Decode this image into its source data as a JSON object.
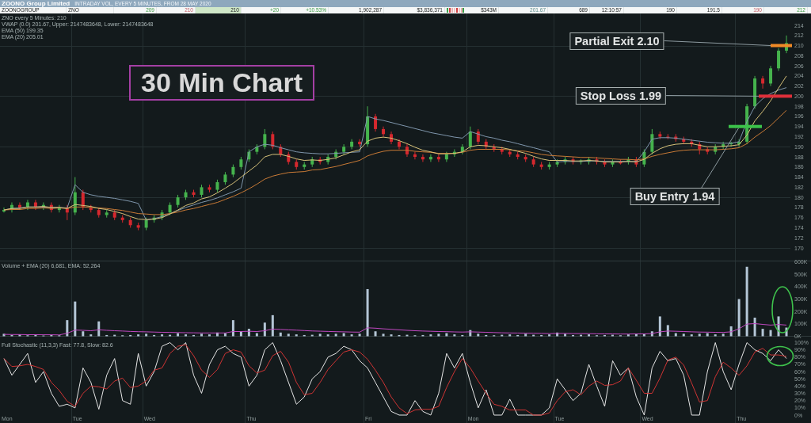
{
  "title_bar": {
    "title": "ZOONO Group Limited",
    "subtitle": "INTRADAY VOL, EVERY 5 MINUTES, FROM 28 MAY 2020"
  },
  "quote_row": [
    {
      "kind": "label",
      "text": "ZOONOGROUP",
      "highlight": false
    },
    {
      "kind": "label",
      "text": "ZNO",
      "highlight": false
    },
    {
      "kind": "gain",
      "text": "209",
      "highlight": false
    },
    {
      "kind": "loss",
      "text": "210",
      "highlight": false
    },
    {
      "kind": "value",
      "text": "210",
      "highlight": true
    },
    {
      "kind": "gain",
      "text": "+20",
      "highlight": false
    },
    {
      "kind": "gain",
      "text": "+10.53%",
      "highlight": false
    },
    {
      "kind": "value",
      "text": "1,902,287",
      "highlight": false
    },
    {
      "kind": "value",
      "text": "$3,836,371",
      "highlight": false
    },
    {
      "kind": "bars"
    },
    {
      "kind": "value",
      "text": "$343M",
      "highlight": false
    },
    {
      "kind": "average",
      "text": "201.67",
      "highlight": false
    },
    {
      "kind": "value",
      "text": "689",
      "highlight": false
    },
    {
      "kind": "value",
      "text": "12:10:57",
      "highlight": false
    },
    {
      "kind": "value",
      "text": "190",
      "highlight": false
    },
    {
      "kind": "value",
      "text": "191.5",
      "highlight": false
    },
    {
      "kind": "loss",
      "text": "190",
      "highlight": false
    },
    {
      "kind": "gain",
      "text": "212",
      "highlight": false
    }
  ],
  "price_panel": {
    "legend": [
      "ZNO every 5 Minutes: 210",
      "VWAP (0.0) 201.67, Upper: 2147483648, Lower: 2147483648",
      "EMA (50) 199.35",
      "EMA (20) 205.01"
    ],
    "chart_data": {
      "type": "candlestick",
      "title": "30 Min Chart",
      "grid": true,
      "ylim": [
        170,
        214
      ],
      "yticks": [
        170,
        172,
        174,
        176,
        178,
        180,
        182,
        184,
        186,
        188,
        190,
        192,
        194,
        196,
        198,
        200,
        202,
        204,
        206,
        208,
        210,
        212,
        214
      ],
      "ohlc": [
        [
          177.2,
          178,
          177,
          177.5
        ],
        [
          177.5,
          179,
          177,
          178.5
        ],
        [
          178.5,
          179,
          177.5,
          178
        ],
        [
          178,
          179.5,
          177.5,
          179
        ],
        [
          179,
          179.5,
          177.5,
          178
        ],
        [
          178,
          179,
          177.5,
          178.5
        ],
        [
          178.5,
          179,
          177,
          177.5
        ],
        [
          177.5,
          178.5,
          177,
          178
        ],
        [
          178,
          178.5,
          175.5,
          177
        ],
        [
          177,
          184,
          176.5,
          181
        ],
        [
          181,
          181.5,
          177.5,
          178
        ],
        [
          178,
          178.5,
          177,
          177.5
        ],
        [
          177.5,
          178,
          176,
          176.5
        ],
        [
          176.5,
          177.5,
          176,
          177
        ],
        [
          177,
          177.5,
          175.5,
          176
        ],
        [
          176,
          176.5,
          175,
          175.5
        ],
        [
          175.5,
          176,
          174,
          174.5
        ],
        [
          174.5,
          175,
          173.5,
          174
        ],
        [
          174,
          176,
          173.5,
          175.5
        ],
        [
          175.5,
          176.5,
          175,
          176
        ],
        [
          176,
          177.5,
          175.5,
          177
        ],
        [
          177,
          179,
          176.5,
          178.5
        ],
        [
          178.5,
          180.5,
          178,
          180
        ],
        [
          180,
          181.5,
          179.5,
          181
        ],
        [
          181,
          181.5,
          180,
          180.5
        ],
        [
          180.5,
          182.5,
          180,
          182
        ],
        [
          182,
          182.5,
          181,
          181.5
        ],
        [
          181.5,
          183.5,
          181,
          183
        ],
        [
          183,
          185,
          182.5,
          184.5
        ],
        [
          184.5,
          186.5,
          184,
          186
        ],
        [
          186,
          188,
          185.5,
          187.5
        ],
        [
          187.5,
          189.5,
          187,
          189
        ],
        [
          189,
          190.5,
          188.5,
          190
        ],
        [
          190,
          193.5,
          189.5,
          192.5
        ],
        [
          192.5,
          193,
          189.5,
          190
        ],
        [
          190,
          190.5,
          188,
          188.5
        ],
        [
          188.5,
          189,
          186.5,
          187
        ],
        [
          187,
          187.5,
          185.5,
          186
        ],
        [
          186,
          187,
          185.5,
          186.5
        ],
        [
          186.5,
          188,
          186,
          187.5
        ],
        [
          187.5,
          188,
          186.5,
          187
        ],
        [
          187,
          188.5,
          186.5,
          188
        ],
        [
          188,
          189.5,
          187.5,
          189
        ],
        [
          189,
          190.5,
          188.5,
          190
        ],
        [
          190,
          191.5,
          189.5,
          191
        ],
        [
          191,
          191.5,
          190,
          190.5
        ],
        [
          190.5,
          198,
          190,
          196
        ],
        [
          196,
          196.5,
          193,
          193.5
        ],
        [
          193.5,
          194,
          192,
          192.5
        ],
        [
          192.5,
          193,
          190.5,
          191
        ],
        [
          191,
          191.5,
          189.5,
          190
        ],
        [
          190,
          190.5,
          188,
          188.5
        ],
        [
          188.5,
          189,
          187.5,
          188
        ],
        [
          188,
          188.5,
          187,
          187.5
        ],
        [
          187.5,
          188.5,
          187,
          188
        ],
        [
          188,
          188.5,
          187,
          187.5
        ],
        [
          187.5,
          189,
          187,
          188.5
        ],
        [
          188.5,
          189.5,
          188,
          189
        ],
        [
          189,
          190.5,
          188.5,
          190
        ],
        [
          190,
          194,
          189.5,
          193
        ],
        [
          193,
          193.5,
          190.5,
          191
        ],
        [
          191,
          191.5,
          189.5,
          190
        ],
        [
          190,
          190.5,
          189,
          189.5
        ],
        [
          189.5,
          190,
          188.5,
          189
        ],
        [
          189,
          189.5,
          188,
          188.5
        ],
        [
          188.5,
          189,
          187.5,
          188
        ],
        [
          188,
          188.5,
          187,
          187.5
        ],
        [
          187.5,
          188,
          186,
          186.5
        ],
        [
          186.5,
          187,
          185.5,
          186
        ],
        [
          186,
          187,
          185.5,
          186.5
        ],
        [
          186.5,
          187.5,
          186,
          187
        ],
        [
          187,
          188,
          186.5,
          187.5
        ],
        [
          187.5,
          188,
          186.5,
          187
        ],
        [
          187,
          187.5,
          186.5,
          187.3
        ],
        [
          187,
          188,
          186.5,
          187.5
        ],
        [
          187.5,
          188,
          186.5,
          187
        ],
        [
          187,
          187.5,
          186,
          186.5
        ],
        [
          186.5,
          187.5,
          186,
          187
        ],
        [
          187,
          187.5,
          186.5,
          186.7
        ],
        [
          187,
          188,
          186.5,
          187.5
        ],
        [
          187.5,
          188,
          186,
          186.5
        ],
        [
          186.5,
          189.5,
          186,
          189
        ],
        [
          189,
          193.5,
          188.5,
          192.5
        ],
        [
          192.5,
          193,
          191.5,
          192
        ],
        [
          192,
          192.5,
          191.5,
          191.8
        ],
        [
          192,
          192.5,
          191,
          191.5
        ],
        [
          191.5,
          192,
          190.5,
          191
        ],
        [
          191,
          191.5,
          190,
          190.5
        ],
        [
          190.5,
          191,
          188.5,
          189.5
        ],
        [
          189.5,
          190,
          188.5,
          189
        ],
        [
          189,
          190.5,
          188.5,
          190
        ],
        [
          190,
          191,
          189.5,
          190.5
        ],
        [
          190.5,
          191,
          190,
          190.7
        ],
        [
          190.5,
          191.5,
          190,
          191
        ],
        [
          191,
          198.5,
          190.5,
          198
        ],
        [
          198,
          204,
          197.5,
          203.5
        ],
        [
          203.5,
          204,
          201.5,
          202.5
        ],
        [
          202.5,
          206,
          202,
          205.5
        ],
        [
          205.5,
          209.5,
          205,
          209
        ],
        [
          209,
          212,
          208.5,
          210.5
        ]
      ],
      "series": [
        {
          "type": "line",
          "color": "#7f96ac",
          "values": [
            177.5,
            177.8,
            177.9,
            178.1,
            178.1,
            178.1,
            178.0,
            178.0,
            177.9,
            182.5,
            181.0,
            180.5,
            180.2,
            180.0,
            179.8,
            179.5,
            179.2,
            178.8,
            175.5,
            175.8,
            176.2,
            176.8,
            177.4,
            178.0,
            178.5,
            179.0,
            179.4,
            179.9,
            180.5,
            181.1,
            181.8,
            189.0,
            190.0,
            190.5,
            190.3,
            189.8,
            189.4,
            189.0,
            188.8,
            188.7,
            188.6,
            188.6,
            188.7,
            188.8,
            188.9,
            189.0,
            196.0,
            195.5,
            195.2,
            194.8,
            194.4,
            194.0,
            193.6,
            193.2,
            192.8,
            192.5,
            192.2,
            191.9,
            191.7,
            193.0,
            192.5,
            192.0,
            191.7,
            191.3,
            191.0,
            190.6,
            190.2,
            189.8,
            189.4,
            189.0,
            187.0,
            187.1,
            187.1,
            187.1,
            187.2,
            187.2,
            187.1,
            187.1,
            187.1,
            187.1,
            187.1,
            189.0,
            191.5,
            191.8,
            191.8,
            191.7,
            191.5,
            191.3,
            191.1,
            190.9,
            190.8,
            190.7,
            190.7,
            191.0,
            195.0,
            198.0,
            199.5,
            200.5,
            201.2,
            201.7
          ]
        },
        {
          "type": "line",
          "color": "#c97a36",
          "values": [
            177.5,
            177.6,
            177.6,
            177.8,
            177.8,
            177.9,
            177.8,
            177.9,
            177.8,
            178.1,
            178.1,
            178.0,
            177.9,
            177.8,
            177.6,
            177.4,
            177.1,
            176.8,
            176.7,
            176.6,
            176.6,
            176.8,
            177.1,
            177.5,
            177.8,
            178.2,
            178.6,
            179.0,
            179.6,
            180.2,
            180.9,
            181.7,
            182.6,
            183.6,
            184.2,
            184.6,
            184.9,
            185.0,
            185.1,
            185.4,
            185.5,
            185.8,
            186.1,
            186.5,
            186.9,
            187.3,
            188.2,
            188.7,
            189.1,
            189.3,
            189.3,
            189.3,
            189.1,
            189.0,
            188.9,
            188.7,
            188.7,
            188.7,
            188.9,
            189.3,
            189.5,
            189.5,
            189.5,
            189.5,
            189.4,
            189.2,
            189.1,
            188.8,
            188.5,
            188.3,
            188.2,
            188.1,
            188.0,
            187.9,
            187.9,
            187.8,
            187.7,
            187.6,
            187.5,
            187.5,
            187.4,
            187.6,
            188.1,
            188.5,
            188.8,
            189.1,
            189.3,
            189.4,
            189.4,
            189.4,
            189.4,
            189.5,
            189.6,
            189.8,
            190.6,
            191.9,
            193.0,
            194.2,
            195.7,
            197.2
          ]
        },
        {
          "type": "line",
          "color": "#d8c27a",
          "values": [
            177.5,
            177.8,
            177.8,
            178.1,
            178.1,
            178.2,
            178.0,
            178.0,
            177.8,
            178.6,
            178.4,
            178.2,
            177.8,
            177.6,
            177.2,
            176.8,
            176.2,
            175.7,
            175.6,
            175.7,
            176.0,
            176.7,
            177.5,
            178.4,
            178.9,
            179.7,
            180.1,
            180.9,
            181.8,
            182.8,
            184.0,
            185.2,
            186.4,
            188.0,
            188.5,
            188.5,
            188.1,
            187.6,
            187.3,
            187.4,
            187.3,
            187.5,
            187.8,
            188.4,
            189.0,
            189.4,
            191.1,
            191.7,
            191.9,
            191.7,
            191.2,
            190.6,
            189.9,
            189.3,
            189.0,
            188.6,
            188.6,
            188.7,
            189.0,
            190.0,
            190.3,
            190.2,
            190.0,
            189.8,
            189.5,
            189.1,
            188.7,
            188.1,
            187.6,
            187.3,
            187.3,
            187.3,
            187.2,
            187.2,
            187.3,
            187.2,
            187.0,
            187.0,
            187.0,
            187.1,
            187.0,
            187.5,
            188.7,
            189.6,
            190.2,
            190.5,
            190.6,
            190.6,
            190.3,
            190.0,
            190.0,
            190.1,
            190.2,
            190.4,
            192.3,
            195.1,
            197.0,
            199.1,
            201.6,
            204.0
          ]
        }
      ]
    },
    "callouts": [
      {
        "text": "Partial Exit 2.10",
        "color": "#f08a26"
      },
      {
        "text": "Stop Loss 1.99",
        "color": "#e0303a"
      },
      {
        "text": "Buy Entry 1.94",
        "color": "#3cc24a"
      }
    ]
  },
  "volume_panel": {
    "legend": "Volume + EMA (20) 6,681, EMA: 52,264",
    "chart_data": {
      "type": "bar",
      "grid": true,
      "ylim": [
        0,
        600
      ],
      "yticks": [
        {
          "value": 0,
          "label": "0K"
        },
        {
          "value": 100,
          "label": "100K"
        },
        {
          "value": 200,
          "label": "200K"
        },
        {
          "value": 300,
          "label": "300K"
        },
        {
          "value": 400,
          "label": "400K"
        },
        {
          "value": 500,
          "label": "500K"
        },
        {
          "value": 600,
          "label": "600K"
        }
      ],
      "series": [
        {
          "color": "#b4c6d6",
          "values": [
            20,
            10,
            15,
            8,
            12,
            6,
            10,
            8,
            130,
            280,
            40,
            15,
            120,
            10,
            12,
            8,
            10,
            15,
            20,
            10,
            15,
            12,
            25,
            15,
            10,
            20,
            15,
            30,
            25,
            130,
            40,
            60,
            25,
            110,
            170,
            30,
            20,
            15,
            10,
            12,
            20,
            15,
            20,
            25,
            15,
            20,
            380,
            40,
            20,
            15,
            10,
            12,
            8,
            10,
            15,
            20,
            25,
            15,
            10,
            50,
            20,
            10,
            8,
            12,
            15,
            10,
            20,
            12,
            10,
            15,
            30,
            20,
            10,
            12,
            15,
            8,
            10,
            12,
            8,
            15,
            20,
            20,
            40,
            160,
            90,
            25,
            20,
            15,
            20,
            25,
            15,
            20,
            80,
            300,
            560,
            150,
            60,
            50,
            160,
            70
          ]
        },
        {
          "type": "line",
          "color": "#c048c0",
          "values": [
            15,
            14,
            14,
            13,
            13,
            12,
            12,
            11,
            24,
            50,
            48,
            45,
            52,
            48,
            45,
            42,
            39,
            37,
            36,
            34,
            32,
            31,
            30,
            29,
            28,
            27,
            27,
            27,
            27,
            38,
            38,
            40,
            38,
            45,
            58,
            55,
            52,
            49,
            46,
            43,
            41,
            39,
            37,
            36,
            34,
            33,
            68,
            65,
            60,
            56,
            52,
            48,
            45,
            42,
            40,
            38,
            37,
            35,
            34,
            36,
            34,
            32,
            30,
            28,
            27,
            26,
            25,
            24,
            23,
            22,
            23,
            23,
            22,
            22,
            21,
            20,
            19,
            19,
            18,
            18,
            19,
            19,
            22,
            36,
            42,
            40,
            38,
            36,
            34,
            33,
            32,
            31,
            36,
            60,
            98,
            102,
            96,
            90,
            95,
            90
          ]
        }
      ]
    }
  },
  "stochastic_panel": {
    "legend": "Full Stochastic (11,3,3) Fast: 77.8, Slow: 82.6",
    "chart_data": {
      "type": "line",
      "grid": true,
      "ylim": [
        0,
        100
      ],
      "yticks": [
        {
          "value": 0,
          "label": "0%"
        },
        {
          "value": 10,
          "label": "10%"
        },
        {
          "value": 20,
          "label": "20%"
        },
        {
          "value": 30,
          "label": "30%"
        },
        {
          "value": 40,
          "label": "40%"
        },
        {
          "value": 50,
          "label": "50%"
        },
        {
          "value": 60,
          "label": "60%"
        },
        {
          "value": 70,
          "label": "70%"
        },
        {
          "value": 80,
          "label": "80%"
        },
        {
          "value": 90,
          "label": "90%"
        },
        {
          "value": 100,
          "label": "100%"
        }
      ],
      "categories": [
        "Mon",
        null,
        null,
        null,
        null,
        null,
        null,
        null,
        null,
        "Tue",
        null,
        null,
        null,
        null,
        null,
        null,
        null,
        null,
        "Wed",
        null,
        null,
        null,
        null,
        null,
        null,
        null,
        null,
        null,
        null,
        null,
        null,
        "Thu",
        null,
        null,
        null,
        null,
        null,
        null,
        null,
        null,
        null,
        null,
        null,
        null,
        null,
        null,
        "Fri",
        null,
        null,
        null,
        null,
        null,
        null,
        null,
        null,
        null,
        null,
        null,
        null,
        "Mon",
        null,
        null,
        null,
        null,
        null,
        null,
        null,
        null,
        null,
        null,
        "Tue",
        null,
        null,
        null,
        null,
        null,
        null,
        null,
        null,
        null,
        null,
        "Wed",
        null,
        null,
        null,
        null,
        null,
        null,
        null,
        null,
        null,
        null,
        null,
        "Thu",
        null,
        null,
        null,
        null,
        null,
        null
      ],
      "series": [
        {
          "color": "#e6e6e6",
          "values": [
            78,
            55,
            70,
            85,
            45,
            60,
            30,
            12,
            15,
            10,
            65,
            45,
            8,
            55,
            78,
            20,
            15,
            85,
            40,
            60,
            95,
            100,
            90,
            100,
            55,
            30,
            70,
            90,
            95,
            85,
            80,
            40,
            55,
            90,
            100,
            75,
            45,
            15,
            25,
            50,
            60,
            80,
            85,
            95,
            90,
            75,
            65,
            45,
            25,
            5,
            0,
            0,
            20,
            5,
            0,
            30,
            85,
            65,
            85,
            45,
            10,
            35,
            0,
            0,
            22,
            0,
            0,
            0,
            0,
            10,
            50,
            35,
            20,
            30,
            70,
            40,
            12,
            75,
            55,
            65,
            25,
            0,
            65,
            88,
            75,
            78,
            55,
            0,
            0,
            60,
            100,
            60,
            35,
            70,
            100,
            90,
            85,
            75,
            90,
            78
          ]
        },
        {
          "color": "#d03434",
          "values": [
            78,
            67,
            68,
            70,
            67,
            63,
            45,
            34,
            19,
            12,
            30,
            40,
            39,
            36,
            47,
            51,
            38,
            40,
            47,
            62,
            65,
            85,
            95,
            97,
            82,
            62,
            52,
            63,
            85,
            90,
            87,
            68,
            58,
            62,
            82,
            88,
            73,
            45,
            28,
            30,
            45,
            63,
            75,
            87,
            90,
            87,
            77,
            62,
            45,
            25,
            10,
            2,
            7,
            8,
            8,
            12,
            38,
            60,
            78,
            65,
            47,
            30,
            15,
            12,
            7,
            7,
            7,
            0,
            0,
            3,
            20,
            32,
            35,
            28,
            40,
            47,
            41,
            42,
            47,
            65,
            48,
            30,
            30,
            51,
            76,
            80,
            69,
            44,
            18,
            20,
            53,
            73,
            65,
            55,
            68,
            87,
            92,
            83,
            83,
            81
          ]
        }
      ]
    }
  }
}
